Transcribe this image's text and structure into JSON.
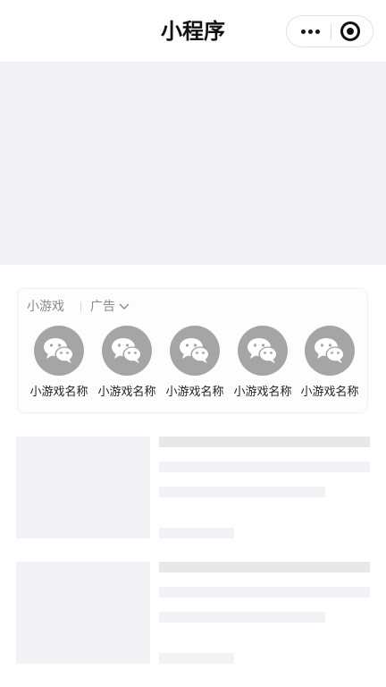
{
  "nav": {
    "title": "小程序",
    "more_icon": "more-dots-icon",
    "close_icon": "target-close-icon"
  },
  "game_section": {
    "title": "小游戏",
    "ad_label": "广告",
    "ad_dropdown_icon": "chevron-down-icon",
    "games": [
      {
        "name": "小游戏名称",
        "icon": "wechat-icon"
      },
      {
        "name": "小游戏名称",
        "icon": "wechat-icon"
      },
      {
        "name": "小游戏名称",
        "icon": "wechat-icon"
      },
      {
        "name": "小游戏名称",
        "icon": "wechat-icon"
      },
      {
        "name": "小游戏名称",
        "icon": "wechat-icon"
      }
    ]
  },
  "colors": {
    "placeholder": "#f2f2f6",
    "skeleton_dark": "#e8e8ea",
    "icon_gray": "#a5a5a5"
  }
}
